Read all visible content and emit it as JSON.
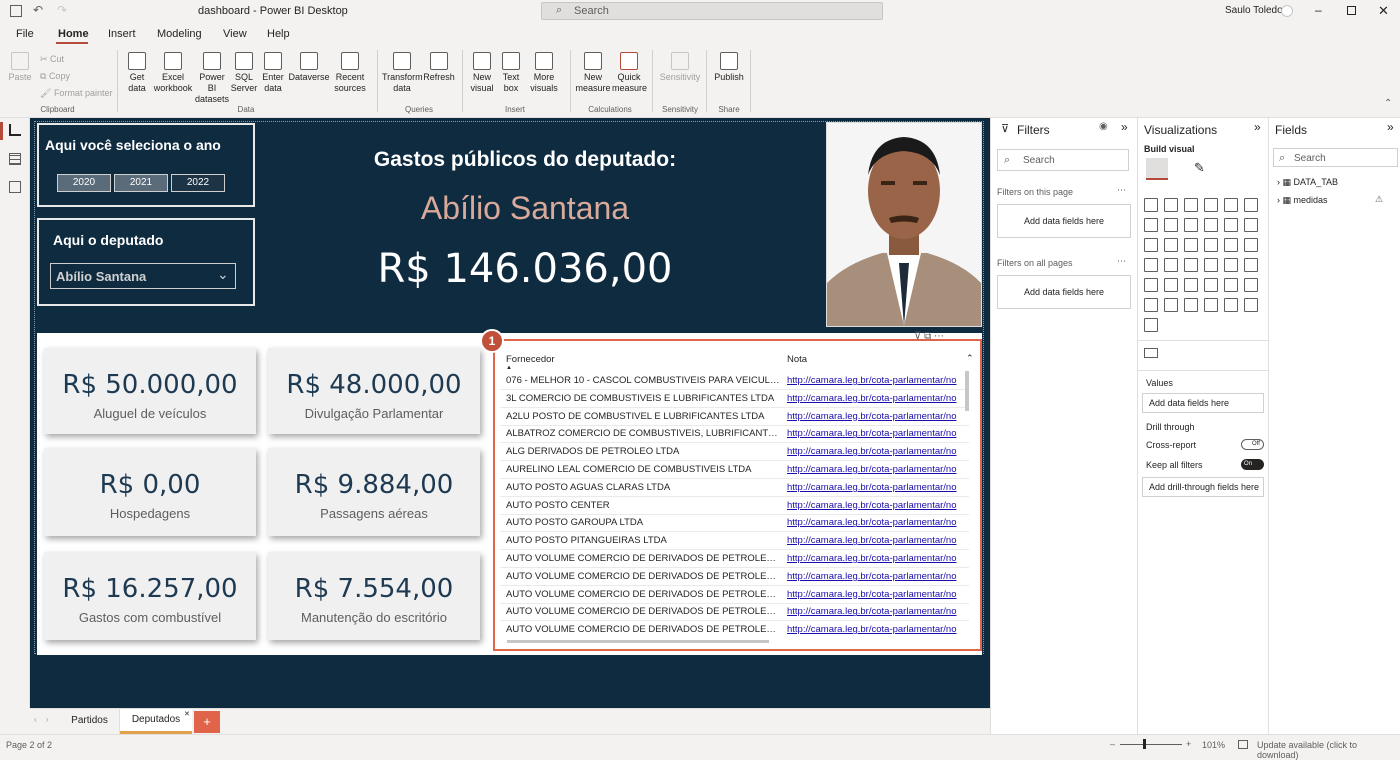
{
  "app": {
    "title": "dashboard - Power BI Desktop",
    "search_placeholder": "Search",
    "user": "Saulo Toledo"
  },
  "menu": [
    "File",
    "Home",
    "Insert",
    "Modeling",
    "View",
    "Help"
  ],
  "ribbon": {
    "clipboard": {
      "paste": "Paste",
      "cut": "Cut",
      "copy": "Copy",
      "format_painter": "Format painter",
      "group": "Clipboard"
    },
    "data": {
      "items": [
        "Get data",
        "Excel workbook",
        "Power BI datasets",
        "SQL Server",
        "Enter data",
        "Dataverse",
        "Recent sources"
      ],
      "group": "Data"
    },
    "queries": {
      "items": [
        "Transform data",
        "Refresh"
      ],
      "group": "Queries"
    },
    "insert": {
      "items": [
        "New visual",
        "Text box",
        "More visuals"
      ],
      "group": "Insert"
    },
    "calculations": {
      "items": [
        "New measure",
        "Quick measure"
      ],
      "group": "Calculations"
    },
    "sensitivity": {
      "items": [
        "Sensitivity"
      ],
      "group": "Sensitivity"
    },
    "share": {
      "items": [
        "Publish"
      ],
      "group": "Share"
    }
  },
  "report": {
    "year_title": "Aqui você seleciona o ano",
    "years": [
      "2020",
      "2021",
      "2022"
    ],
    "deputy_title": "Aqui o deputado",
    "deputy_selected": "Abílio Santana",
    "header": "Gastos públicos do deputado:",
    "deputy_name": "Abílio Santana",
    "total": "R$ 146.036,00",
    "cards": [
      {
        "value": "R$ 50.000,00",
        "label": "Aluguel de veículos"
      },
      {
        "value": "R$ 48.000,00",
        "label": "Divulgação Parlamentar"
      },
      {
        "value": "R$ 0,00",
        "label": "Hospedagens"
      },
      {
        "value": "R$ 9.884,00",
        "label": "Passagens aéreas"
      },
      {
        "value": "R$ 16.257,00",
        "label": "Gastos com combustível"
      },
      {
        "value": "R$ 7.554,00",
        "label": "Manutenção do escritório"
      }
    ],
    "badge": "1",
    "table": {
      "columns": [
        "Fornecedor",
        "Nota"
      ],
      "rows": [
        [
          "076 - MELHOR 10 - CASCOL COMBUSTIVEIS PARA VEICULOS...",
          "http://camara.leg.br/cota-parlamentar/no"
        ],
        [
          "3L COMERCIO DE COMBUSTIVEIS E LUBRIFICANTES LTDA",
          "http://camara.leg.br/cota-parlamentar/no"
        ],
        [
          "A2LU POSTO DE COMBUSTIVEL E LUBRIFICANTES LTDA",
          "http://camara.leg.br/cota-parlamentar/no"
        ],
        [
          "ALBATROZ COMERCIO DE COMBUSTIVEIS, LUBRIFICANTES LT...",
          "http://camara.leg.br/cota-parlamentar/no"
        ],
        [
          "ALG DERIVADOS DE PETROLEO LTDA",
          "http://camara.leg.br/cota-parlamentar/no"
        ],
        [
          "AURELINO LEAL COMERCIO DE COMBUSTIVEIS LTDA",
          "http://camara.leg.br/cota-parlamentar/no"
        ],
        [
          "AUTO POSTO AGUAS CLARAS LTDA",
          "http://camara.leg.br/cota-parlamentar/no"
        ],
        [
          "AUTO POSTO CENTER",
          "http://camara.leg.br/cota-parlamentar/no"
        ],
        [
          "AUTO POSTO GAROUPA LTDA",
          "http://camara.leg.br/cota-parlamentar/no"
        ],
        [
          "AUTO POSTO PITANGUEIRAS LTDA",
          "http://camara.leg.br/cota-parlamentar/no"
        ],
        [
          "AUTO VOLUME COMERCIO DE DERIVADOS DE PETROLEO LT...",
          "http://camara.leg.br/cota-parlamentar/no"
        ],
        [
          "AUTO VOLUME COMERCIO DE DERIVADOS DE PETROLEO LT...",
          "http://camara.leg.br/cota-parlamentar/no"
        ],
        [
          "AUTO VOLUME COMERCIO DE DERIVADOS DE PETROLEO LT...",
          "http://camara.leg.br/cota-parlamentar/no"
        ],
        [
          "AUTO VOLUME COMERCIO DE DERIVADOS DE PETROLEO LT...",
          "http://camara.leg.br/cota-parlamentar/no"
        ],
        [
          "AUTO VOLUME COMERCIO DE DERIVADOS DE PETROLEO LT...",
          "http://camara.leg.br/cota-parlamentar/no"
        ]
      ]
    }
  },
  "filters": {
    "title": "Filters",
    "search": "Search",
    "on_page": "Filters on this page",
    "on_all": "Filters on all pages",
    "add": "Add data fields here"
  },
  "visualizations": {
    "title": "Visualizations",
    "build": "Build visual",
    "values": "Values",
    "add_values": "Add data fields here",
    "drill": "Drill through",
    "cross_report": "Cross-report",
    "cross_state": "Off",
    "keep_filters": "Keep all filters",
    "keep_state": "On",
    "add_drill": "Add drill-through fields here"
  },
  "fields": {
    "title": "Fields",
    "search": "Search",
    "items": [
      "DATA_TAB",
      "medidas"
    ]
  },
  "pages": [
    "Partidos",
    "Deputados"
  ],
  "status": {
    "page": "Page 2 of 2",
    "zoom": "101%",
    "update": "Update available (click to download)"
  }
}
